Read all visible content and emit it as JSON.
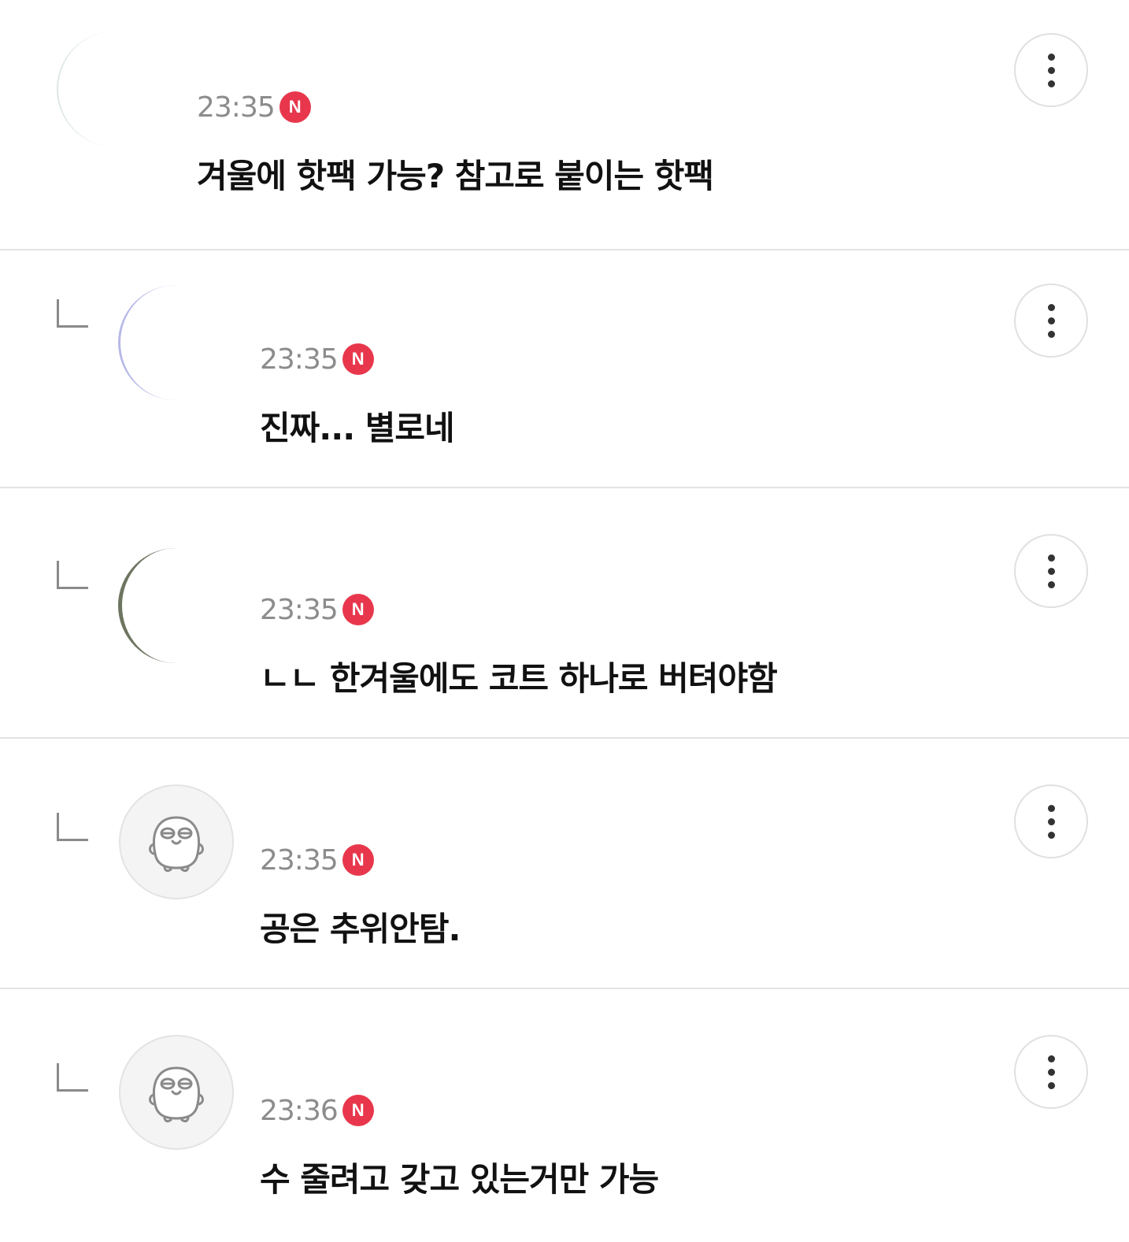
{
  "comments": [
    {
      "time": "23:35",
      "badge": "N",
      "text": "겨울에 핫팩 가능? 참고로 붙이는 핫팩",
      "avatar_icon": "profile-photo-icon",
      "is_reply": false
    },
    {
      "time": "23:35",
      "badge": "N",
      "text": "진짜... 별로네",
      "avatar_icon": "profile-photo-icon",
      "is_reply": true
    },
    {
      "time": "23:35",
      "badge": "N",
      "text": "ㄴㄴ 한겨울에도 코트 하나로 버텨야함",
      "avatar_icon": "profile-photo-icon",
      "is_reply": true
    },
    {
      "time": "23:35",
      "badge": "N",
      "text": "공은 추위안탐.",
      "avatar_icon": "default-character-avatar-icon",
      "is_reply": true
    },
    {
      "time": "23:36",
      "badge": "N",
      "text": "수 줄려고 갖고 있는거만 가능",
      "avatar_icon": "default-character-avatar-icon",
      "is_reply": true
    }
  ],
  "more_icon": "more-vertical-icon",
  "reply_icon": "reply-arrow-icon",
  "colors": {
    "badge": "#e8374c",
    "time": "#8c8c8c",
    "divider": "#e3e3e3",
    "text": "#111111"
  }
}
